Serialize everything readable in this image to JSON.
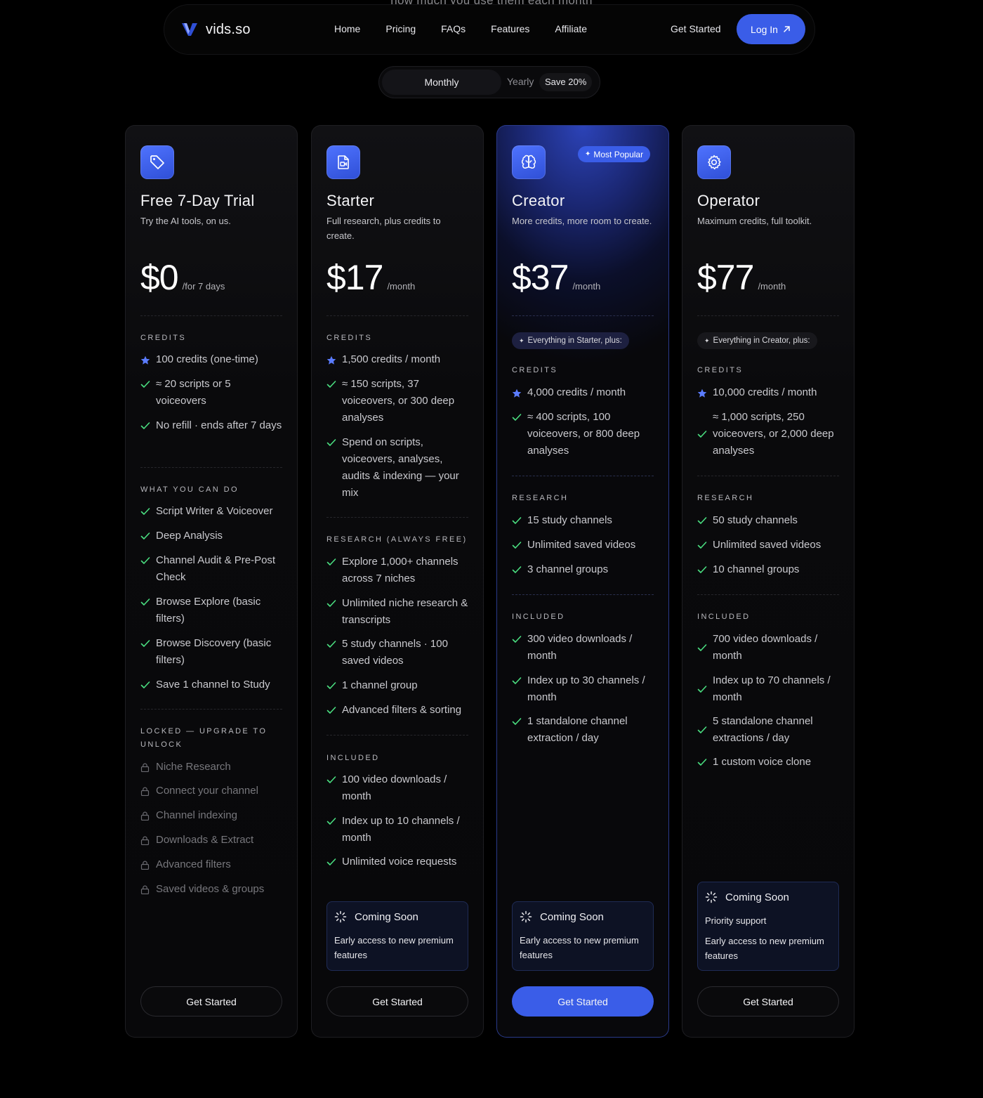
{
  "peek_text": "how much you use them each month",
  "brand": {
    "name": "vids.so",
    "accent": "#3a5de8"
  },
  "nav": {
    "links": [
      "Home",
      "Pricing",
      "FAQs",
      "Features",
      "Affiliate"
    ],
    "get_started": "Get Started",
    "login": "Log In"
  },
  "billing": {
    "monthly": "Monthly",
    "yearly": "Yearly",
    "save": "Save 20%"
  },
  "plans": [
    {
      "name": "Free 7-Day Trial",
      "desc": "Try the AI tools, on us.",
      "price": "$0",
      "per": "/for 7 days",
      "credits_label": "CREDITS",
      "credits": [
        "100 credits (one-time)",
        "≈ 20 scripts or 5 voiceovers",
        "No refill · ends after 7 days"
      ],
      "can_do_label": "WHAT YOU CAN DO",
      "can_do": [
        "Script Writer & Voiceover",
        "Deep Analysis",
        "Channel Audit & Pre-Post Check",
        "Browse Explore (basic filters)",
        "Browse Discovery (basic filters)",
        "Save 1 channel to Study"
      ],
      "locked_label": "LOCKED — UPGRADE TO UNLOCK",
      "locked": [
        "Niche Research",
        "Connect your channel",
        "Channel indexing",
        "Downloads & Extract",
        "Advanced filters",
        "Saved videos & groups"
      ],
      "cta": "Get Started"
    },
    {
      "name": "Starter",
      "desc": "Full research, plus credits to create.",
      "price": "$17",
      "per": "/month",
      "credits_label": "CREDITS",
      "credits": [
        "1,500 credits / month",
        "≈ 150 scripts, 37 voiceovers, or 300 deep analyses",
        "Spend on scripts, voiceovers, analyses, audits & indexing — your mix"
      ],
      "research_label": "RESEARCH (ALWAYS FREE)",
      "research": [
        "Explore 1,000+ channels across 7 niches",
        "Unlimited niche research & transcripts",
        "5 study channels · 100 saved videos",
        "1 channel group",
        "Advanced filters & sorting"
      ],
      "included_label": "INCLUDED",
      "included": [
        "100 video downloads / month",
        "Index up to 10 channels / month",
        "Unlimited voice requests"
      ],
      "soon_title": "Coming Soon",
      "soon_lines": [
        "Early access to new premium features"
      ],
      "cta": "Get Started"
    },
    {
      "name": "Creator",
      "badge": "Most Popular",
      "desc": "More credits, more room to create.",
      "price": "$37",
      "per": "/month",
      "chip": "Everything in Starter, plus:",
      "credits_label": "CREDITS",
      "credits": [
        "4,000 credits / month",
        "≈ 400 scripts, 100 voiceovers, or 800 deep analyses"
      ],
      "research_label": "RESEARCH",
      "research": [
        "15 study channels",
        "Unlimited saved videos",
        "3 channel groups"
      ],
      "included_label": "INCLUDED",
      "included": [
        "300 video downloads / month",
        "Index up to 30 channels / month",
        "1 standalone channel extraction / day"
      ],
      "soon_title": "Coming Soon",
      "soon_lines": [
        "Early access to new premium features"
      ],
      "cta": "Get Started"
    },
    {
      "name": "Operator",
      "desc": "Maximum credits, full toolkit.",
      "price": "$77",
      "per": "/month",
      "chip": "Everything in Creator, plus:",
      "credits_label": "CREDITS",
      "credits": [
        "10,000 credits / month",
        "≈ 1,000 scripts, 250 voiceovers, or 2,000 deep analyses"
      ],
      "research_label": "RESEARCH",
      "research": [
        "50 study channels",
        "Unlimited saved videos",
        "10 channel groups"
      ],
      "included_label": "INCLUDED",
      "included": [
        "700 video downloads / month",
        "Index up to 70 channels / month",
        "5 standalone channel extractions / day",
        "1 custom voice clone"
      ],
      "soon_title": "Coming Soon",
      "soon_lines": [
        "Priority support",
        "Early access to new premium features"
      ],
      "cta": "Get Started"
    }
  ]
}
